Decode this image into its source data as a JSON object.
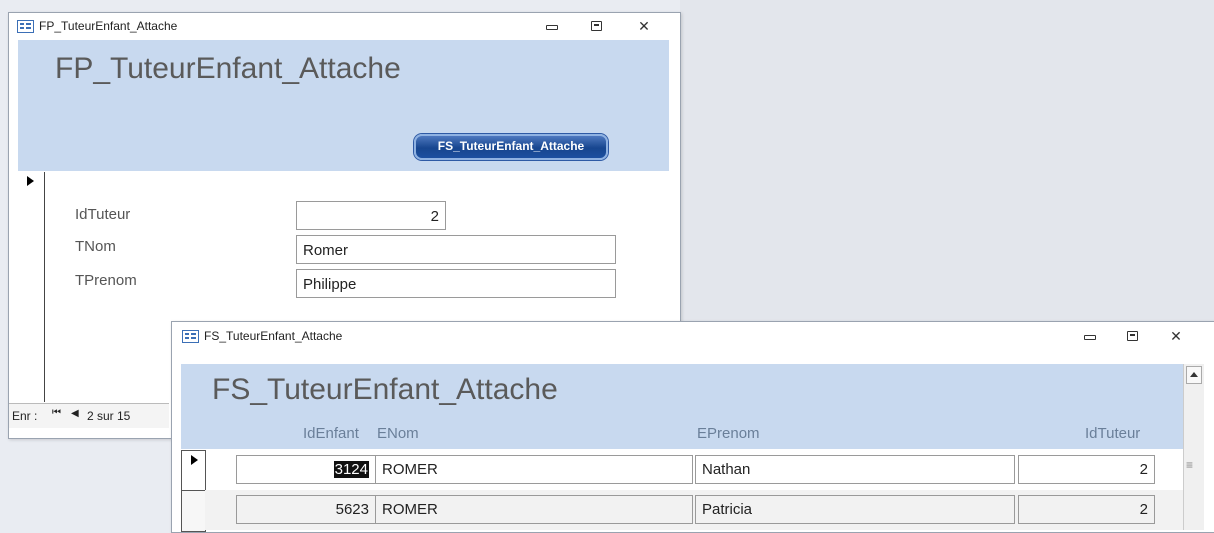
{
  "main_form": {
    "window_title": "FP_TuteurEnfant_Attache",
    "heading": "FP_TuteurEnfant_Attache",
    "subform_button_label": "FS_TuteurEnfant_Attache",
    "fields": [
      {
        "label": "IdTuteur",
        "value": "2"
      },
      {
        "label": "TNom",
        "value": "Romer"
      },
      {
        "label": "TPrenom",
        "value": "Philippe"
      }
    ],
    "navigation": {
      "prefix": "Enr :",
      "first": "⏮",
      "prev": "◀",
      "position": "2 sur 15"
    }
  },
  "subform": {
    "window_title": "FS_TuteurEnfant_Attache",
    "heading": "FS_TuteurEnfant_Attache",
    "columns": [
      "IdEnfant",
      "ENom",
      "EPrenom",
      "IdTuteur"
    ],
    "rows": [
      {
        "idenfant": "3124",
        "enom": "ROMER",
        "eprenom": "Nathan",
        "idtuteur": "2"
      },
      {
        "idenfant": "5623",
        "enom": "ROMER",
        "eprenom": "Patricia",
        "idtuteur": "2"
      }
    ]
  },
  "window_controls": {
    "minimize": "minimize",
    "maximize": "maximize",
    "close": "✕"
  }
}
